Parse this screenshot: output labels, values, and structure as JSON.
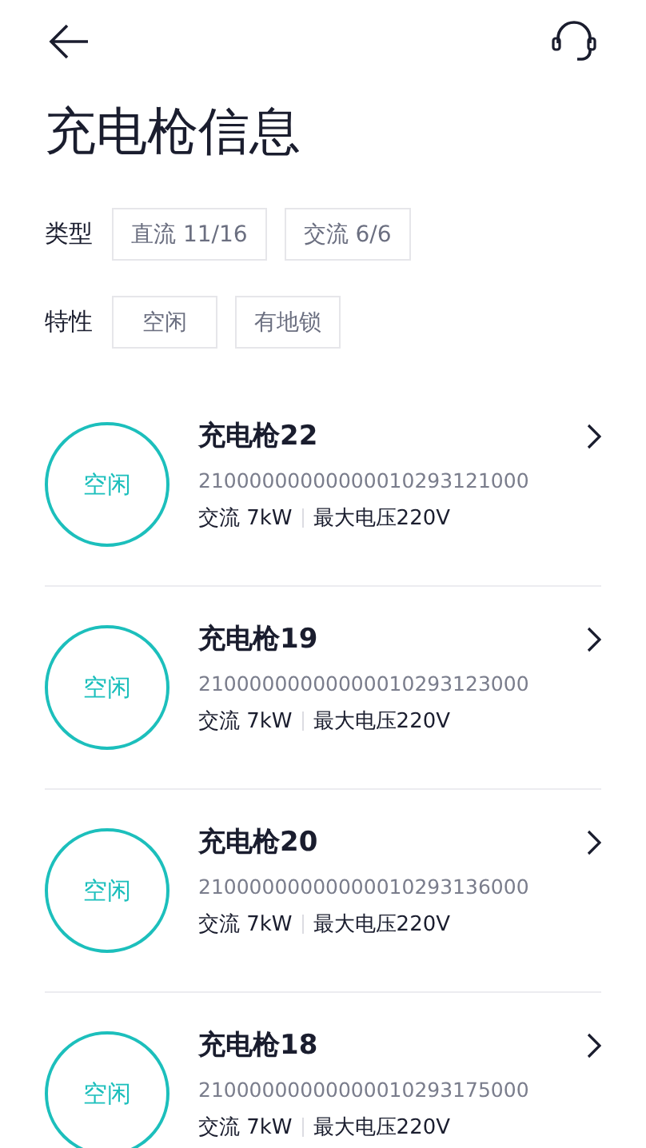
{
  "header": {
    "title": "充电枪信息"
  },
  "filters": [
    {
      "label": "类型",
      "options": [
        {
          "label": "直流 11/16",
          "selected": false
        },
        {
          "label": "交流 6/6",
          "selected": false
        }
      ]
    },
    {
      "label": "特性",
      "options": [
        {
          "label": "空闲",
          "selected": false
        },
        {
          "label": "有地锁",
          "selected": false
        }
      ]
    }
  ],
  "guns": [
    {
      "status": "空闲",
      "name": "充电枪22",
      "code": "21000000000000010293121000",
      "type": "交流 7kW",
      "voltage": "最大电压220V"
    },
    {
      "status": "空闲",
      "name": "充电枪19",
      "code": "21000000000000010293123000",
      "type": "交流 7kW",
      "voltage": "最大电压220V"
    },
    {
      "status": "空闲",
      "name": "充电枪20",
      "code": "21000000000000010293136000",
      "type": "交流 7kW",
      "voltage": "最大电压220V"
    },
    {
      "status": "空闲",
      "name": "充电枪18",
      "code": "21000000000000010293175000",
      "type": "交流 7kW",
      "voltage": "最大电压220V"
    }
  ]
}
